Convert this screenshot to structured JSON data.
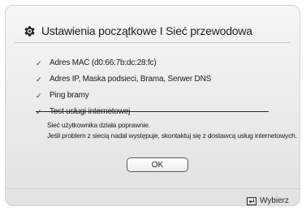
{
  "dialog": {
    "title": "Ustawienia początkowe I Sieć przewodowa",
    "title_icon": "gear-icon",
    "checks": [
      {
        "label": "Adres MAC (d0:66:7b:dc:28:fc)",
        "icon": "checkmark-icon"
      },
      {
        "label": "Adres IP, Maska podsieci, Brama, Serwer DNS",
        "icon": "checkmark-icon"
      },
      {
        "label": "Ping bramy",
        "icon": "checkmark-icon"
      },
      {
        "label": "Test usługi internetowej",
        "icon": "checkmark-icon"
      }
    ],
    "message_line1": "Sieć użytkownika działa poprawnie.",
    "message_line2": "Jeśli problem z siecią nadal występuje, skontaktuj się z dostawcą usług internetowych.",
    "ok_label": "OK"
  },
  "footer": {
    "select_label": "Wybierz",
    "select_icon": "enter-icon"
  },
  "colors": {
    "background": "#e9e9e9",
    "text": "#1b1b1b"
  }
}
